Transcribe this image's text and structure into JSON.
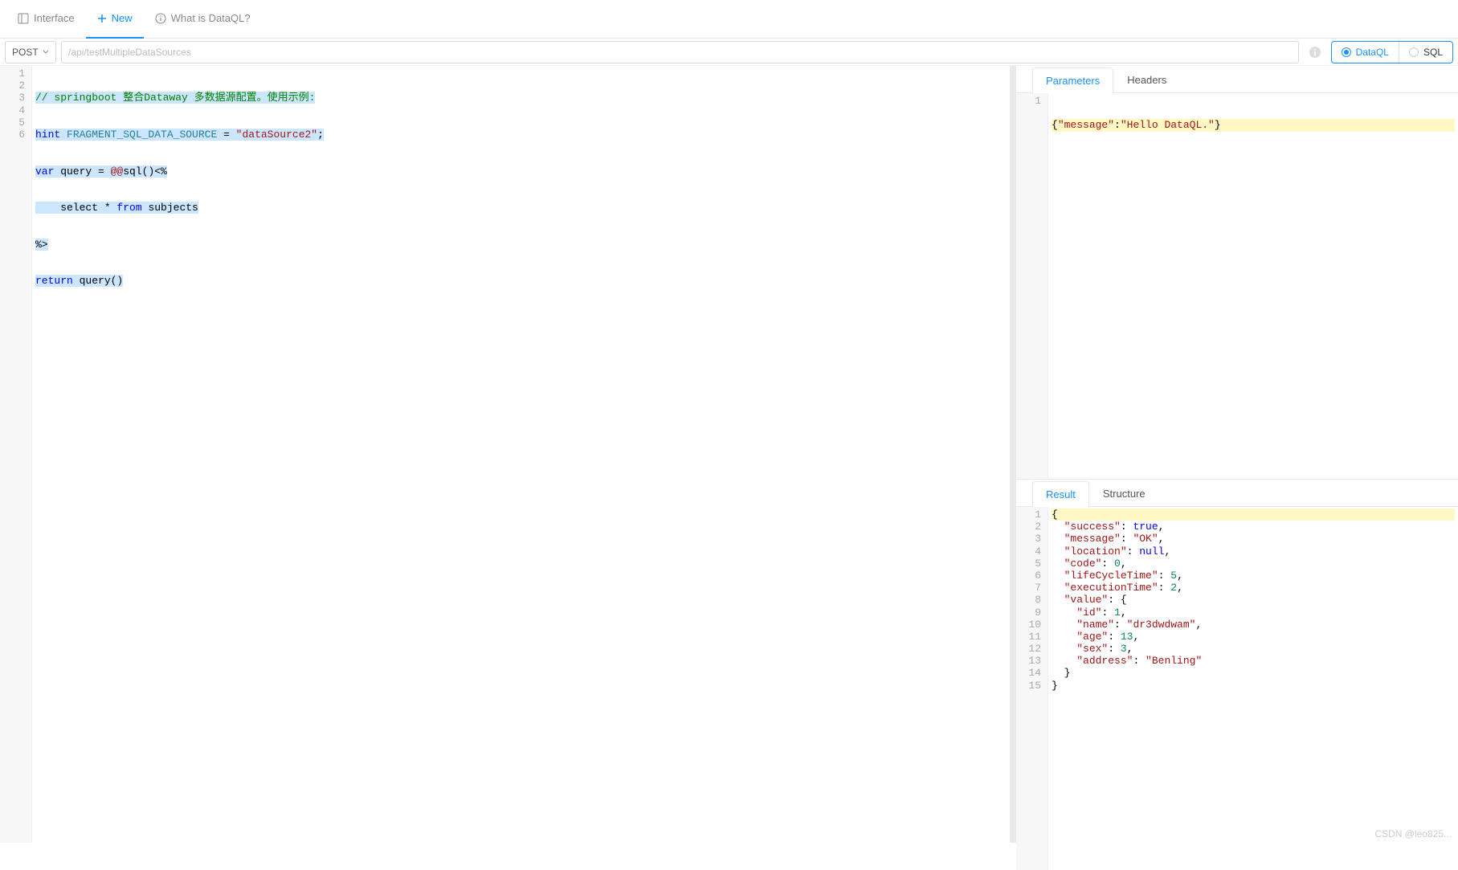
{
  "topTabs": {
    "interface": "Interface",
    "new": "New",
    "help": "What is DataQL?"
  },
  "request": {
    "method": "POST",
    "url": "/api/testMultipleDataSources",
    "radios": {
      "dataql": "DataQL",
      "sql": "SQL"
    }
  },
  "codeLines": {
    "l1_comment": "// springboot 整合Dataway 多数据源配置。使用示例:",
    "l2_hint": "hint",
    "l2_ident": " FRAGMENT_SQL_DATA_SOURCE ",
    "l2_eq": "=",
    "l2_str": " \"dataSource2\"",
    "l2_semi": ";",
    "l3_var": "var",
    "l3_rest": " query = ",
    "l3_at": "@@",
    "l3_sql": "sql()<%",
    "l4_indent": "    select * ",
    "l4_from": "from",
    "l4_tbl": " subjects",
    "l5": "%>",
    "l6_ret": "return",
    "l6_call": " query()"
  },
  "rightTop": {
    "tabs": {
      "parameters": "Parameters",
      "headers": "Headers"
    },
    "json_key": "\"message\"",
    "json_val": "\"Hello DataQL.\""
  },
  "rightBottom": {
    "tabs": {
      "result": "Result",
      "structure": "Structure"
    },
    "lines": [
      {
        "n": 1,
        "indent": "",
        "raw": "{"
      },
      {
        "n": 2,
        "indent": "  ",
        "key": "\"success\"",
        "sep": ": ",
        "val": "true",
        "comma": ",",
        "vtype": "kw"
      },
      {
        "n": 3,
        "indent": "  ",
        "key": "\"message\"",
        "sep": ": ",
        "val": "\"OK\"",
        "comma": ",",
        "vtype": "str"
      },
      {
        "n": 4,
        "indent": "  ",
        "key": "\"location\"",
        "sep": ": ",
        "val": "null",
        "comma": ",",
        "vtype": "kw"
      },
      {
        "n": 5,
        "indent": "  ",
        "key": "\"code\"",
        "sep": ": ",
        "val": "0",
        "comma": ",",
        "vtype": "num"
      },
      {
        "n": 6,
        "indent": "  ",
        "key": "\"lifeCycleTime\"",
        "sep": ": ",
        "val": "5",
        "comma": ",",
        "vtype": "num"
      },
      {
        "n": 7,
        "indent": "  ",
        "key": "\"executionTime\"",
        "sep": ": ",
        "val": "2",
        "comma": ",",
        "vtype": "num"
      },
      {
        "n": 8,
        "indent": "  ",
        "key": "\"value\"",
        "sep": ": ",
        "val": "{",
        "comma": "",
        "vtype": "op"
      },
      {
        "n": 9,
        "indent": "    ",
        "key": "\"id\"",
        "sep": ": ",
        "val": "1",
        "comma": ",",
        "vtype": "num"
      },
      {
        "n": 10,
        "indent": "    ",
        "key": "\"name\"",
        "sep": ": ",
        "val": "\"dr3dwdwam\"",
        "comma": ",",
        "vtype": "str"
      },
      {
        "n": 11,
        "indent": "    ",
        "key": "\"age\"",
        "sep": ": ",
        "val": "13",
        "comma": ",",
        "vtype": "num"
      },
      {
        "n": 12,
        "indent": "    ",
        "key": "\"sex\"",
        "sep": ": ",
        "val": "3",
        "comma": ",",
        "vtype": "num"
      },
      {
        "n": 13,
        "indent": "    ",
        "key": "\"address\"",
        "sep": ": ",
        "val": "\"Benling\"",
        "comma": "",
        "vtype": "str"
      },
      {
        "n": 14,
        "indent": "  ",
        "raw": "}"
      },
      {
        "n": 15,
        "indent": "",
        "raw": "}"
      }
    ]
  },
  "watermark": "CSDN @leo825..."
}
